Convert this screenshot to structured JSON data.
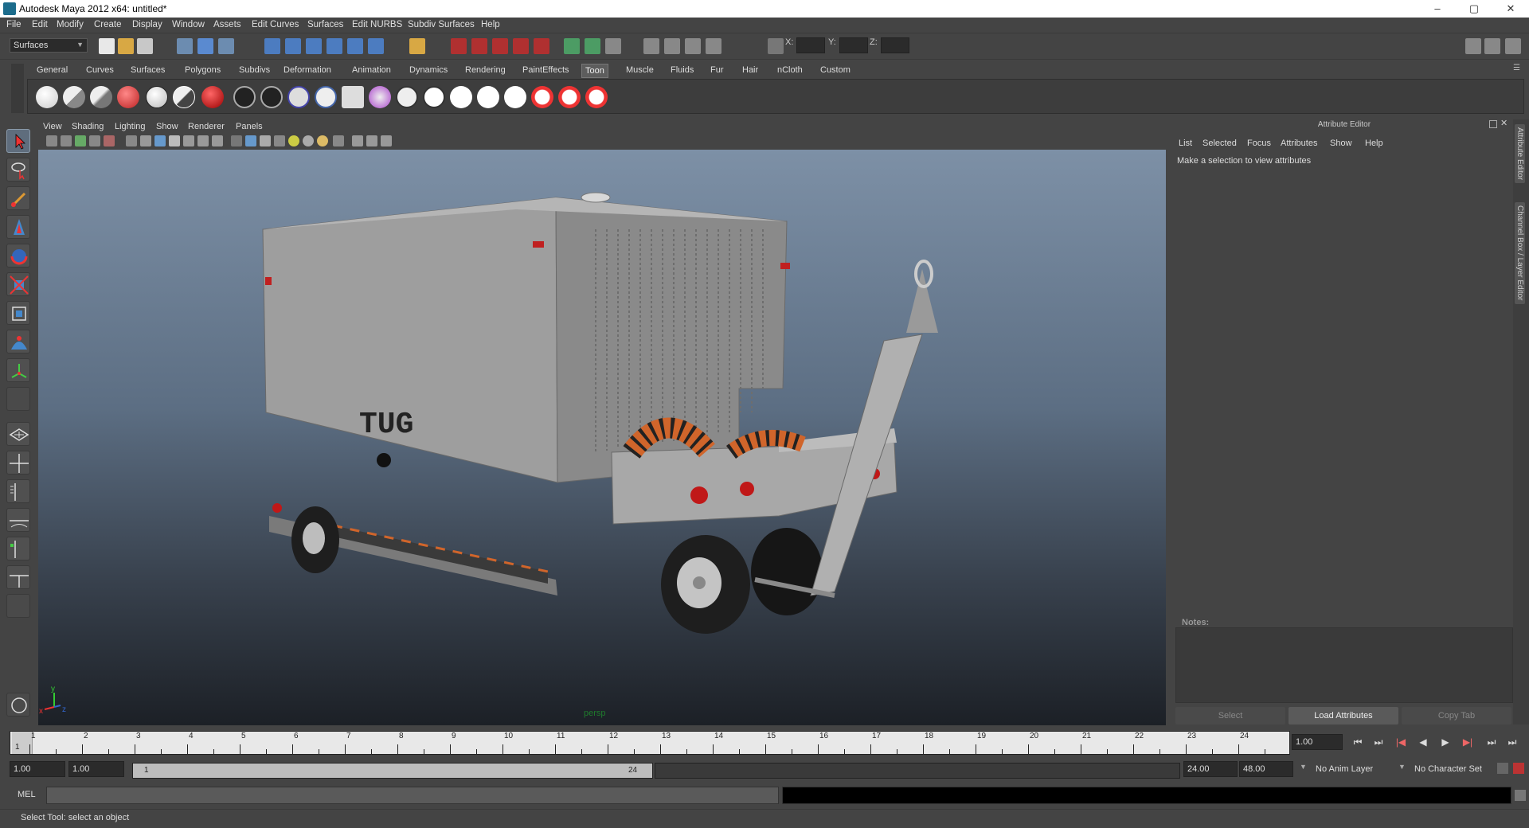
{
  "window": {
    "title": "Autodesk Maya 2012 x64: untitled*",
    "minimize": "–",
    "maximize": "▢",
    "close": "✕"
  },
  "menus": [
    "File",
    "Edit",
    "Modify",
    "Create",
    "Display",
    "Window",
    "Assets",
    "Edit Curves",
    "Surfaces",
    "Edit NURBS",
    "Subdiv Surfaces",
    "Help"
  ],
  "status": {
    "mode": "Surfaces",
    "x_label": "X:",
    "y_label": "Y:",
    "z_label": "Z:"
  },
  "shelf_tabs": [
    "General",
    "Curves",
    "Surfaces",
    "Polygons",
    "Subdivs",
    "Deformation",
    "Animation",
    "Dynamics",
    "Rendering",
    "PaintEffects",
    "Toon",
    "Muscle",
    "Fluids",
    "Fur",
    "Hair",
    "nCloth",
    "Custom"
  ],
  "shelf_active_tab": "Toon",
  "panel_menu": [
    "View",
    "Shading",
    "Lighting",
    "Show",
    "Renderer",
    "Panels"
  ],
  "viewport": {
    "camera_label": "persp",
    "model_text": "TUG",
    "axis_x": "x",
    "axis_y": "y",
    "axis_z": "z"
  },
  "attribute_editor": {
    "title": "Attribute Editor",
    "menu": [
      "List",
      "Selected",
      "Focus",
      "Attributes",
      "Show",
      "Help"
    ],
    "message": "Make a selection to view attributes",
    "notes_label": "Notes:",
    "buttons": {
      "select": "Select",
      "load": "Load Attributes",
      "copy": "Copy Tab"
    }
  },
  "side_tabs": [
    "Attribute Editor",
    "Channel Box / Layer Editor"
  ],
  "timeline": {
    "ticks": [
      "1",
      "2",
      "3",
      "4",
      "5",
      "6",
      "7",
      "8",
      "9",
      "10",
      "11",
      "12",
      "13",
      "14",
      "15",
      "16",
      "17",
      "18",
      "19",
      "20",
      "21",
      "22",
      "23",
      "24"
    ],
    "current_frame": "1",
    "current_time_field": "1.00"
  },
  "range": {
    "start_time": "1.00",
    "playback_start": "1.00",
    "range_start_label": "1",
    "range_end_label": "24",
    "playback_end": "24.00",
    "end_time": "48.00",
    "anim_layer": "No Anim Layer",
    "character_set": "No Character Set"
  },
  "command_line": {
    "label": "MEL"
  },
  "help_line": {
    "text": "Select Tool: select an object"
  }
}
